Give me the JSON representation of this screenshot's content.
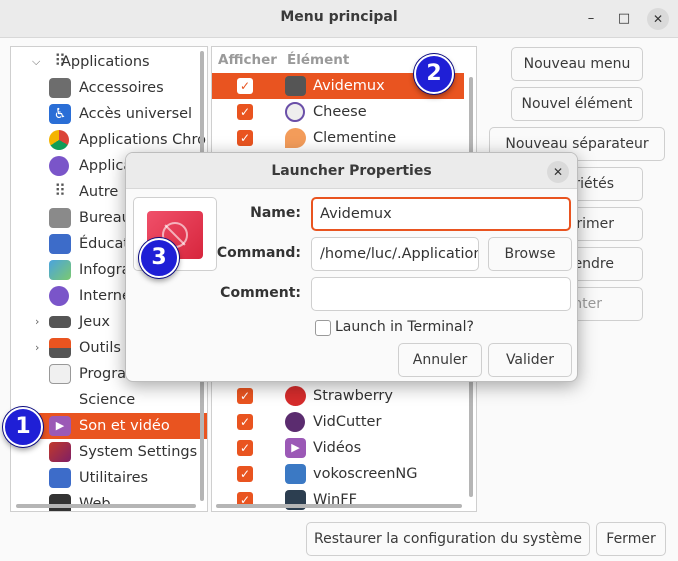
{
  "window": {
    "title": "Menu principal",
    "controls": {
      "minimize": "–",
      "maximize": "□",
      "close": "✕"
    }
  },
  "tree": {
    "items": [
      {
        "label": "Applications",
        "icon": "apps-grid-icon",
        "expander": "expanded"
      },
      {
        "label": "Accessoires",
        "icon": "accessories-icon"
      },
      {
        "label": "Accès universel",
        "icon": "accessibility-icon"
      },
      {
        "label": "Applications Chro",
        "icon": "chrome-icon"
      },
      {
        "label": "Applica",
        "icon": "chrome-apps-icon"
      },
      {
        "label": "Autre",
        "icon": "grid-icon"
      },
      {
        "label": "Bureau",
        "icon": "desktop-settings-icon"
      },
      {
        "label": "Éducat",
        "icon": "education-icon"
      },
      {
        "label": "Infogra",
        "icon": "graphics-icon"
      },
      {
        "label": "Interne",
        "icon": "internet-icon"
      },
      {
        "label": "Jeux",
        "icon": "gamepad-icon",
        "expander": "collapsed"
      },
      {
        "label": "Outils S",
        "icon": "system-tools-icon",
        "expander": "collapsed"
      },
      {
        "label": "Progra",
        "icon": "programming-icon"
      },
      {
        "label": "Science",
        "icon": "science-icon"
      },
      {
        "label": "Son et vidéo",
        "icon": "multimedia-icon",
        "selected": true
      },
      {
        "label": "System Settings",
        "icon": "system-settings-icon"
      },
      {
        "label": "Utilitaires",
        "icon": "utilities-icon"
      },
      {
        "label": "Web",
        "icon": "web-icon"
      }
    ]
  },
  "list": {
    "headers": {
      "show": "Afficher",
      "item": "Élément"
    },
    "rows_top": [
      {
        "label": "Avidemux",
        "icon": "avidemux-icon",
        "checked": true,
        "selected": true
      },
      {
        "label": "Cheese",
        "icon": "cheese-icon",
        "checked": true
      },
      {
        "label": "Clementine",
        "icon": "clementine-icon",
        "checked": true
      }
    ],
    "rows_bottom": [
      {
        "label": "Strawberry",
        "icon": "strawberry-icon",
        "checked": true
      },
      {
        "label": "VidCutter",
        "icon": "vidcutter-icon",
        "checked": true
      },
      {
        "label": "Vidéos",
        "icon": "videos-icon",
        "checked": true
      },
      {
        "label": "vokoscreenNG",
        "icon": "vokoscreen-icon",
        "checked": true
      },
      {
        "label": "WinFF",
        "icon": "winff-icon",
        "checked": true
      }
    ],
    "checkmark": "✓"
  },
  "side_buttons": {
    "new_menu": "Nouveau menu",
    "new_item": "Nouvel élément",
    "new_separator": "Nouveau séparateur",
    "properties_partial": "riétés",
    "delete_partial": "rimer",
    "move_partial": "endre",
    "move2_partial": "nter"
  },
  "bottom_buttons": {
    "restore": "Restaurer la configuration du système",
    "close": "Fermer"
  },
  "dialog": {
    "title": "Launcher Properties",
    "close": "✕",
    "icon": "launcher-icon-forbidden",
    "name_label": "Name:",
    "name_value": "Avidemux",
    "command_label": "Command:",
    "command_value": "/home/luc/.Application",
    "browse": "Browse",
    "comment_label": "Comment:",
    "comment_value": "",
    "terminal_label": "Launch in Terminal?",
    "terminal_checked": false,
    "cancel": "Annuler",
    "ok": "Valider"
  },
  "callouts": [
    "1",
    "2",
    "3"
  ],
  "colors": {
    "accent": "#e95420",
    "callout": "#1f1fd6"
  }
}
